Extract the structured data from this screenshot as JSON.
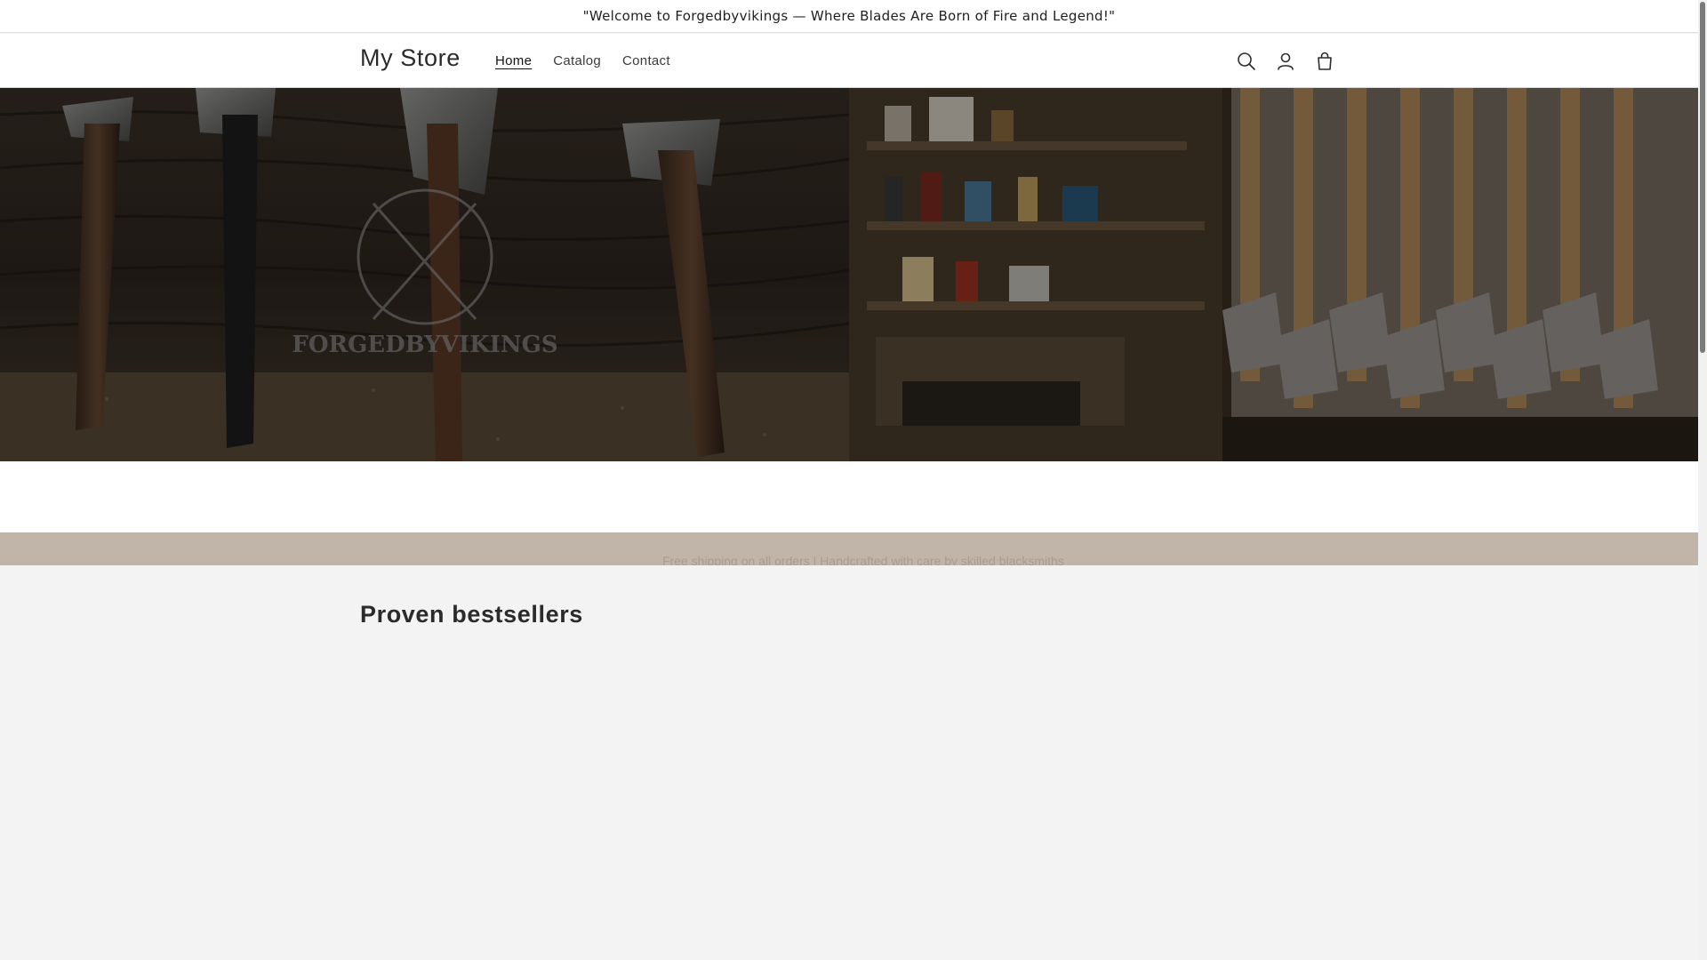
{
  "announcement": {
    "text": "\"Welcome to Forgedbyvikings — Where Blades Are Born of Fire and Legend!\""
  },
  "header": {
    "logo": "My Store",
    "nav": [
      {
        "label": "Home",
        "active": true
      },
      {
        "label": "Catalog",
        "active": false
      },
      {
        "label": "Contact",
        "active": false
      }
    ],
    "icons": [
      "search-icon",
      "account-icon",
      "cart-icon"
    ]
  },
  "hero": {
    "watermark": "FORGEDBYVIKINGS"
  },
  "band": {
    "text": "Free shipping on all orders | Handcrafted with care by skilled blacksmiths"
  },
  "bestsellers": {
    "title": "Proven bestsellers"
  }
}
